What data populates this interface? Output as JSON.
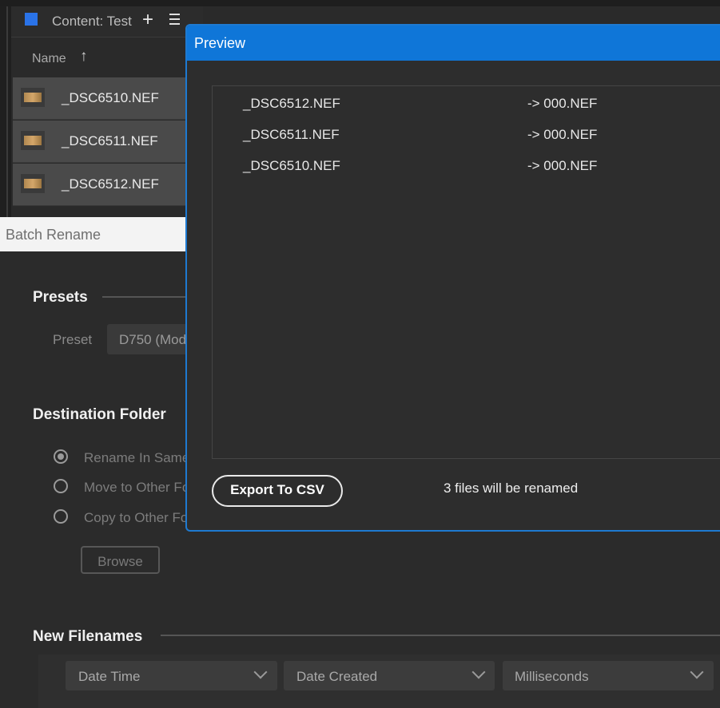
{
  "content_panel": {
    "title": "Content: Test",
    "add_icon": "+",
    "menu_icon": "hamburger-menu",
    "column_name": "Name",
    "sort_icon": "↑",
    "files": [
      "_DSC6510.NEF",
      "_DSC6511.NEF",
      "_DSC6512.NEF"
    ]
  },
  "batch_rename": {
    "title": "Batch Rename",
    "presets": {
      "title": "Presets",
      "preset_label": "Preset",
      "preset_value": "D750 (Mod"
    },
    "destination": {
      "title": "Destination Folder",
      "options": [
        "Rename In Same",
        "Move to Other Fo",
        "Copy to Other Fo"
      ],
      "selected_index": 0,
      "browse_label": "Browse"
    },
    "new_filenames": {
      "title": "New Filenames",
      "selects": [
        "Date Time",
        "Date Created",
        "Milliseconds"
      ]
    }
  },
  "preview": {
    "title": "Preview",
    "rows": [
      {
        "old": "_DSC6512.NEF",
        "new": "-> 000.NEF"
      },
      {
        "old": "_DSC6511.NEF",
        "new": "-> 000.NEF"
      },
      {
        "old": "_DSC6510.NEF",
        "new": "-> 000.NEF"
      }
    ],
    "export_label": "Export To CSV",
    "status": "3 files will be renamed"
  },
  "colors": {
    "accent": "#0f76d8",
    "panel_icon": "#2a73e8"
  }
}
